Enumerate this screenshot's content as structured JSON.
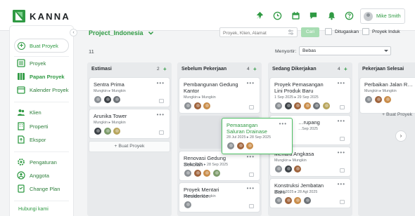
{
  "brand": {
    "name": "KANNA",
    "accent": "#2f9a43"
  },
  "topbar": {
    "icons": [
      "pin-icon",
      "clock-icon",
      "calendar-icon",
      "chat-icon",
      "bell-icon",
      "help-icon"
    ],
    "user_name": "Mike Smith"
  },
  "sidebar": {
    "new_project": "Buat Proyek",
    "collapse": "‹",
    "items": [
      {
        "label": "Proyek",
        "icon": "list-icon"
      },
      {
        "label": "Papan Proyek",
        "icon": "board-icon"
      },
      {
        "label": "Kalender Proyek",
        "icon": "calendar-icon"
      },
      {
        "label": "Klien",
        "icon": "people-icon"
      },
      {
        "label": "Properti",
        "icon": "building-icon"
      },
      {
        "label": "Ekspor",
        "icon": "export-icon"
      },
      {
        "label": "Pengaturan",
        "icon": "gear-icon"
      },
      {
        "label": "Anggota",
        "icon": "member-icon"
      },
      {
        "label": "Change Plan",
        "icon": "plan-icon"
      }
    ],
    "help": "Hubungi kami"
  },
  "header": {
    "project": "Project_Indonesia",
    "search_placeholder": "Proyek, Klien, Alamat",
    "search_button": "Cari",
    "check_done": "Ditugaskan",
    "check_parent": "Proyek Induk",
    "total": "11",
    "sort_label": "Menyortir:",
    "sort_value": "Bebas"
  },
  "board": {
    "add_project": "+ Buat Proyek",
    "columns": [
      {
        "title": "Estimasi",
        "count": "2",
        "add": "+",
        "cards": [
          {
            "title": "Sentra Prima",
            "meta": "Mungkin ▸ Mungkin"
          },
          {
            "title": "Arunika Tower",
            "meta": "Mungkin ▸ Mungkin"
          }
        ]
      },
      {
        "title": "Sebelum Pekerjaan",
        "count": "4",
        "add": "+",
        "cards": [
          {
            "title": "Pembangunan Gedung Kantor",
            "meta": "Mungkin ▸ Mungkin"
          },
          {
            "title": "Renovasi Gedung Sekolah",
            "meta": "28 Jul 2025 ▸ 28 Sep 2025"
          },
          {
            "title": "Proyek Mentari Residence",
            "meta": "Mungkin ▸ Mungkin"
          }
        ]
      },
      {
        "title": "Sedang Dikerjakan",
        "count": "4",
        "add": "+",
        "cards": [
          {
            "title": "Proyek Pemasangan Lini Produk Baru",
            "meta": "1 Sep 2025 ▸ 29 Sep 2025"
          },
          {
            "title": "…rupang",
            "meta": "…Sep 2025"
          },
          {
            "title": "Menara Angkasa",
            "meta": "Mungkin ▸ Mungkin"
          },
          {
            "title": "Konstruksi Jembatan Baru",
            "meta": "28 Jul 2025 ▸ 28 Agt 2025"
          }
        ]
      },
      {
        "title": "Pekerjaan Selesai",
        "count": "",
        "add": "",
        "cards": [
          {
            "title": "Perbaikan Jalan R…",
            "meta": "Mungkin ▸ Mungkin"
          }
        ]
      }
    ],
    "dragging": {
      "title": "Pemasangan Saluran Drainase",
      "meta": "28 Jul 2025 ▸ 28 Sep 2025"
    },
    "next": "›"
  }
}
